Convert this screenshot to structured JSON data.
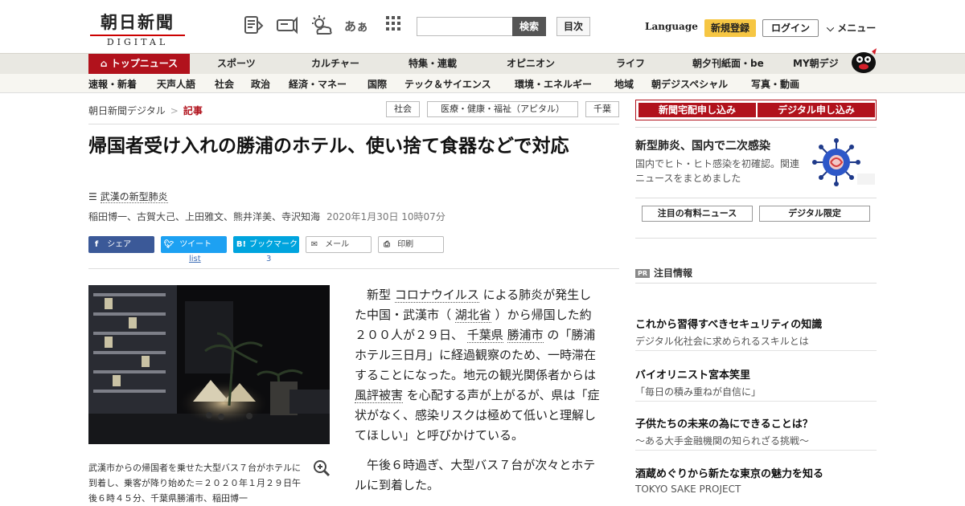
{
  "header": {
    "logo_line1": "朝日新聞",
    "logo_line2": "DIGITAL",
    "search_button": "検索",
    "toc_button": "目次",
    "language": "Language",
    "register": "新規登録",
    "login": "ログイン",
    "menu": "メニュー",
    "font_size_glyph": "あぁ"
  },
  "gnav": [
    "トップニュース",
    "スポーツ",
    "カルチャー",
    "特集・連載",
    "オピニオン",
    "ライフ",
    "朝夕刊紙面・be",
    "MY朝デジ"
  ],
  "subnav": [
    "速報・新着",
    "天声人語",
    "社会",
    "政治",
    "経済・マネー",
    "国際",
    "テック＆サイエンス",
    "環境・エネルギー",
    "地域",
    "朝デジスペシャル",
    "写真・動画"
  ],
  "breadcrumb": {
    "home": "朝日新聞デジタル",
    "sep": ">",
    "current": "記事"
  },
  "tags": [
    "社会",
    "医療・健康・福祉（アピタル）",
    "千葉"
  ],
  "article": {
    "headline": "帰国者受け入れの勝浦のホテル、使い捨て食器などで対応",
    "series": "武漢の新型肺炎",
    "authors": "稲田博一、古賀大己、上田雅文、熊井洋美、寺沢知海",
    "date": "2020年1月30日 10時07分",
    "caption": "武漢市からの帰国者を乗せた大型バス７台がホテルに到着し、乗客が降り始めた＝２０２０年１月２９日午後６時４５分、千葉県勝浦市、稲田博一",
    "p1": [
      {
        "t": "新型 "
      },
      {
        "t": "コロナウイルス",
        "k": 1
      },
      {
        "t": " による肺炎が発生した中国・武漢市（ "
      },
      {
        "t": "湖北省",
        "k": 1
      },
      {
        "t": " ）から帰国した約２００人が２９日、 "
      },
      {
        "t": "千葉県",
        "k": 1
      },
      {
        "t": " "
      },
      {
        "t": "勝浦市",
        "k": 1
      },
      {
        "t": " の「勝浦ホテル三日月」に経過観察のため、一時滞在することになった。地元の観光関係者からは "
      },
      {
        "t": "風評被害",
        "k": 1
      },
      {
        "t": " を心配する声が上がるが、県は「症状がなく、感染リスクは極めて低いと理解してほしい」と呼びかけている。"
      }
    ],
    "p2": "午後６時過ぎ、大型バス７台が次々とホテルに到着した。"
  },
  "share": {
    "facebook": "シェア",
    "twitter": "ツイート",
    "hatena": "ブックマーク",
    "mail": "メール",
    "print": "印刷",
    "twitter_count": "list",
    "hatena_count": "3"
  },
  "sidebar": {
    "sub_paper": "新聞宅配申し込み",
    "sub_digital": "デジタル申し込み",
    "feature_title": "新型肺炎、国内で二次感染",
    "feature_desc": "国内でヒト・ヒト感染を初確認。関連ニュースをまとめました",
    "tab_paid": "注目の有料ニュース",
    "tab_digital": "デジタル限定",
    "pr_label": "PR",
    "pr_head": "注目情報",
    "pr_items": [
      {
        "title": "これから習得すべきセキュリティの知識",
        "sub": "デジタル化社会に求められるスキルとは"
      },
      {
        "title": "バイオリニスト宮本笑里",
        "sub": "「毎日の積み重ねが自信に」"
      },
      {
        "title": "子供たちの未来の為にできることは？",
        "sub": "～ある大手金融機関の知られざる挑戦～"
      },
      {
        "title": "酒蔵めぐりから新たな東京の魅力を知る",
        "sub": "TOKYO SAKE PROJECT"
      }
    ]
  },
  "colors": {
    "brand_red": "#b1121c",
    "register_yellow": "#f6c643",
    "facebook": "#3b5998",
    "twitter": "#1da1f2",
    "hatena": "#00a4de"
  }
}
